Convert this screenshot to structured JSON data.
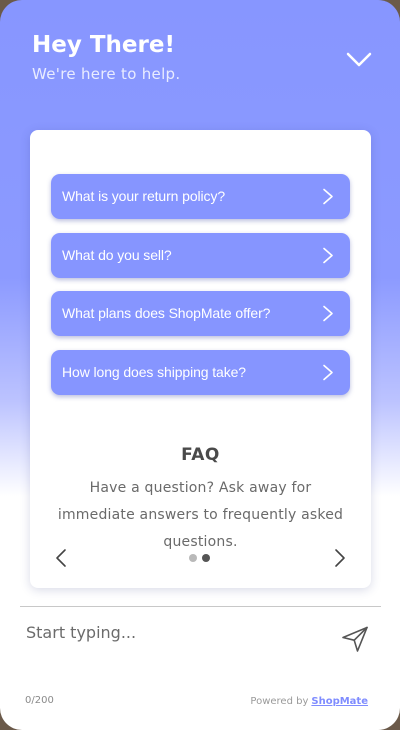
{
  "header": {
    "title": "Hey There!",
    "subtitle": "We're here to help."
  },
  "faq": {
    "items": [
      {
        "label": "What is your return policy?"
      },
      {
        "label": "What do you sell?"
      },
      {
        "label": "What plans does ShopMate offer?"
      },
      {
        "label": "How long does shipping take?"
      }
    ],
    "title": "FAQ",
    "description": "Have a question? Ask away for immediate answers to frequently asked questions.",
    "pagination": {
      "total": 2,
      "current": 2
    }
  },
  "composer": {
    "placeholder": "Start typing...",
    "value": "",
    "counter": "0/200"
  },
  "footer": {
    "powered_by": "Powered by",
    "brand": "ShopMate"
  },
  "colors": {
    "accent": "#8695ff",
    "header_gradient_top": "#8796ff",
    "brand_link": "#7f8cff"
  },
  "icons": {
    "collapse": "chevron-down-icon",
    "faq_item": "chevron-right-icon",
    "prev": "chevron-left-icon",
    "next": "chevron-right-icon",
    "send": "send-icon"
  }
}
